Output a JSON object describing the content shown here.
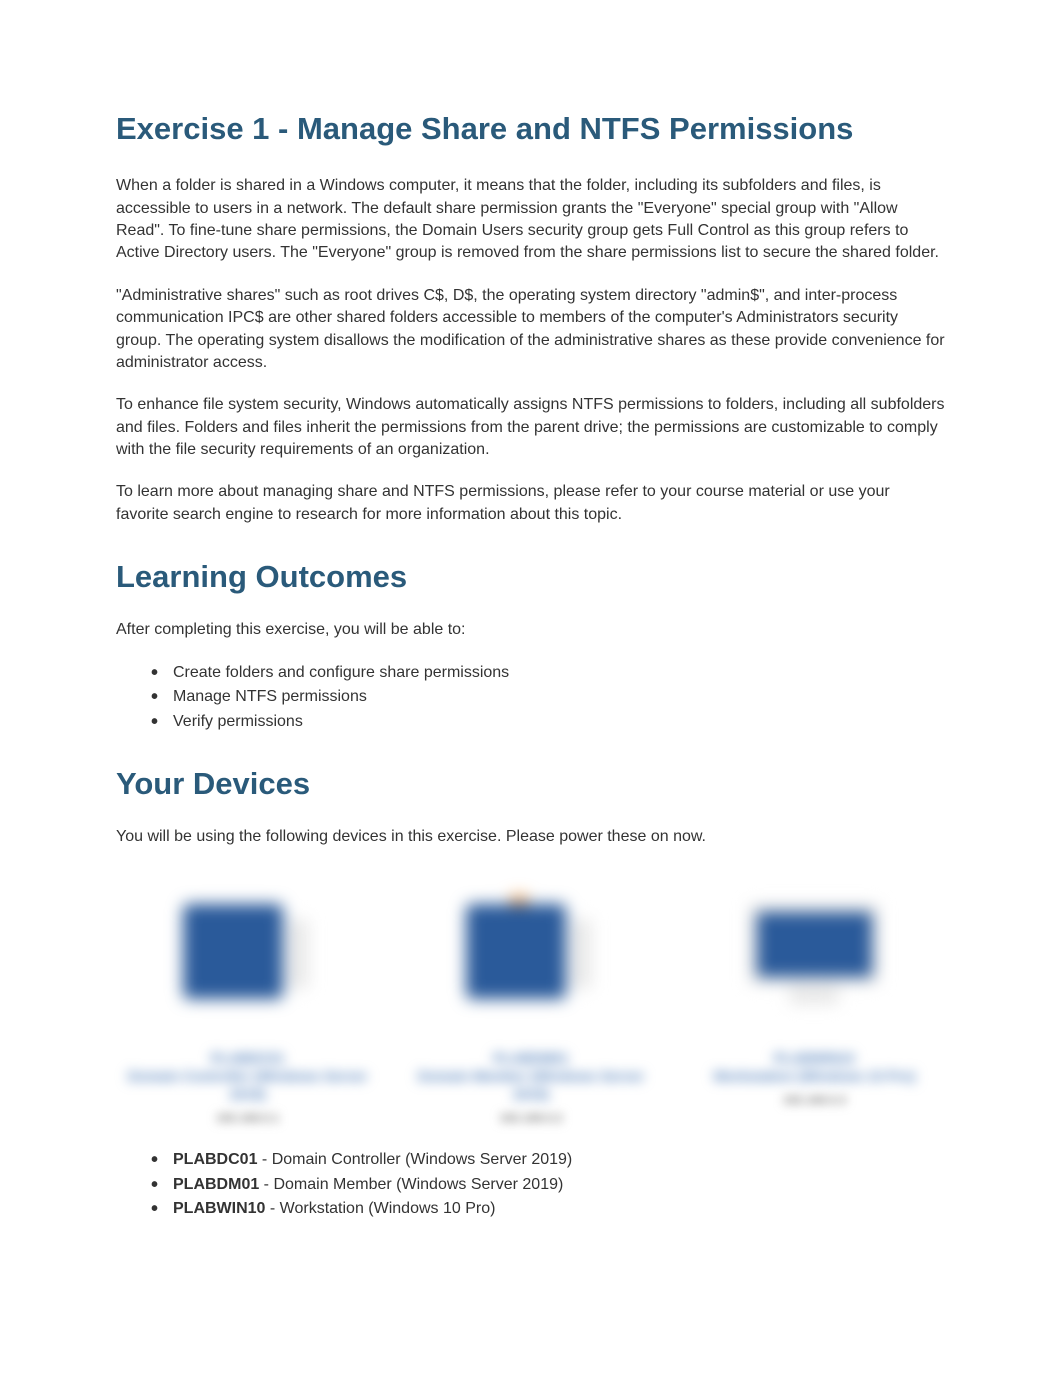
{
  "title": "Exercise 1 - Manage Share and NTFS Permissions",
  "intro": {
    "p1": "When a folder is shared in a Windows computer, it means that the folder, including its subfolders and files, is accessible to users in a network. The default share permission grants the \"Everyone\" special group with \"Allow Read\". To fine-tune share permissions, the Domain Users security group gets Full Control as this group refers to Active Directory users. The \"Everyone\" group is removed from the share permissions list to secure the shared folder.",
    "p2": "\"Administrative shares\" such as root drives C$, D$, the operating system directory \"admin$\", and inter-process communication IPC$ are other shared folders accessible to members of the computer's Administrators security group. The operating system disallows the modification of the administrative shares as these provide convenience for administrator access.",
    "p3": "To enhance file system security, Windows automatically assigns NTFS permissions to folders, including all subfolders and files. Folders and files inherit the permissions from the parent drive; the permissions are customizable to comply with the file security requirements of an organization.",
    "p4": "To learn more about managing share and NTFS permissions, please refer to your course material or use your favorite search engine to research for more information about this topic."
  },
  "outcomes": {
    "heading": "Learning Outcomes",
    "lead": "After completing this exercise, you will be able to:",
    "items": [
      "Create folders and configure share permissions",
      "Manage NTFS permissions",
      "Verify permissions"
    ]
  },
  "devices": {
    "heading": "Your Devices",
    "lead": "You will be using the following devices in this exercise. Please power these on now.",
    "cards": [
      {
        "label_top": "PLABDC01",
        "label_mid": "Domain Controller (Windows Server 2019)",
        "sub": "192.168.0.1"
      },
      {
        "label_top": "PLABDM01",
        "label_mid": "Domain Member (Windows Server 2019)",
        "sub": "192.168.0.2"
      },
      {
        "label_top": "PLABWIN10",
        "label_mid": "Workstation (Windows 10 Pro)",
        "sub": "192.168.0.3"
      }
    ],
    "list": [
      {
        "name": "PLABDC01",
        "desc": " - Domain Controller (Windows Server 2019)"
      },
      {
        "name": "PLABDM01",
        "desc": " - Domain Member (Windows Server 2019)"
      },
      {
        "name": "PLABWIN10",
        "desc": " - Workstation (Windows 10 Pro)"
      }
    ]
  }
}
